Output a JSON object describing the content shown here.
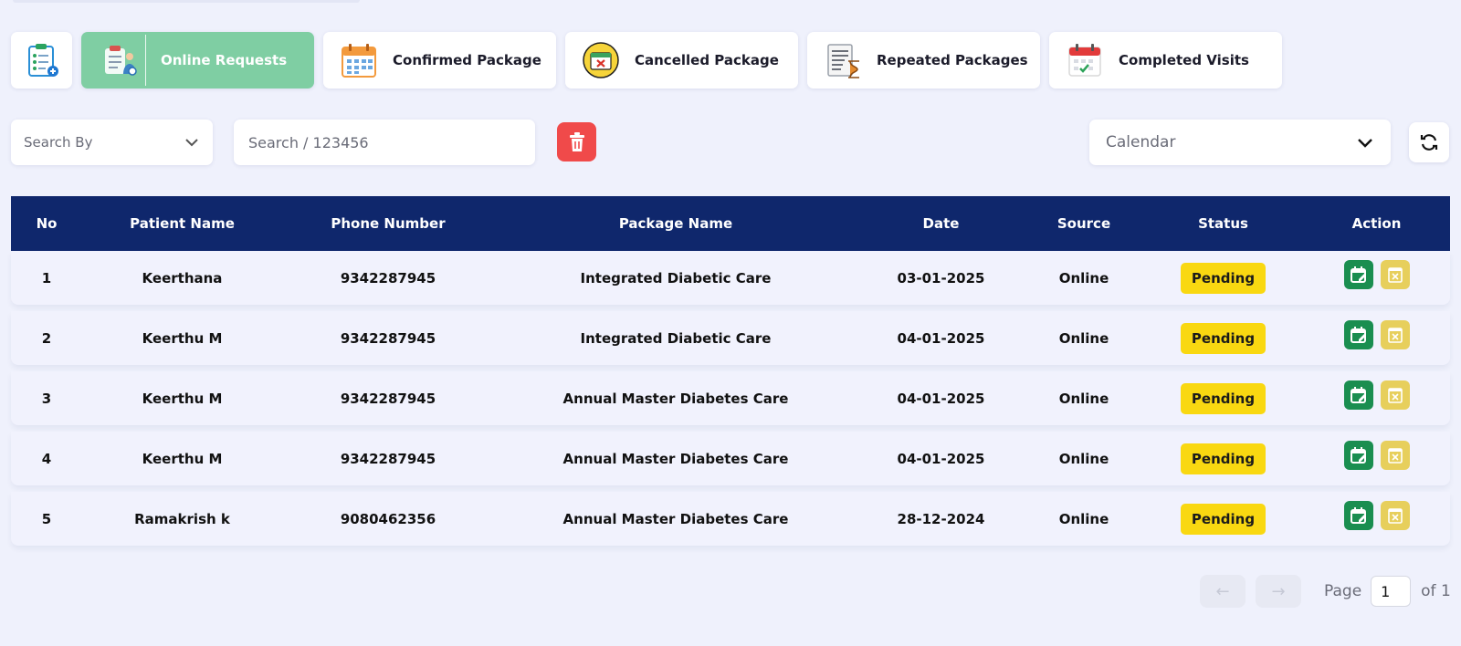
{
  "tabs": {
    "online": "Online Requests",
    "confirmed": "Confirmed Package",
    "cancelled": "Cancelled Package",
    "repeated": "Repeated Packages",
    "completed": "Completed Visits"
  },
  "filters": {
    "search_by": "Search By",
    "search_placeholder": "Search / 123456",
    "calendar": "Calendar"
  },
  "table": {
    "headers": [
      "No",
      "Patient Name",
      "Phone Number",
      "Package Name",
      "Date",
      "Source",
      "Status",
      "Action"
    ],
    "rows": [
      {
        "no": "1",
        "name": "Keerthana",
        "phone": "9342287945",
        "package": "Integrated Diabetic Care",
        "date": "03-01-2025",
        "source": "Online",
        "status": "Pending"
      },
      {
        "no": "2",
        "name": "Keerthu M",
        "phone": "9342287945",
        "package": "Integrated Diabetic Care",
        "date": "04-01-2025",
        "source": "Online",
        "status": "Pending"
      },
      {
        "no": "3",
        "name": "Keerthu M",
        "phone": "9342287945",
        "package": "Annual Master Diabetes Care",
        "date": "04-01-2025",
        "source": "Online",
        "status": "Pending"
      },
      {
        "no": "4",
        "name": "Keerthu M",
        "phone": "9342287945",
        "package": "Annual Master Diabetes Care",
        "date": "04-01-2025",
        "source": "Online",
        "status": "Pending"
      },
      {
        "no": "5",
        "name": "Ramakrish k",
        "phone": "9080462356",
        "package": "Annual Master Diabetes Care",
        "date": "28-12-2024",
        "source": "Online",
        "status": "Pending"
      }
    ]
  },
  "pagination": {
    "prev": "←",
    "next": "→",
    "page_label": "Page",
    "current": "1",
    "of_label": "of 1"
  },
  "colors": {
    "active_tab": "#7fcea3",
    "header": "#0f276c",
    "pending": "#f9d811",
    "delete": "#f04a4a",
    "confirm_action": "#1a8e50",
    "cancel_action": "#e7cf5c"
  },
  "icons": [
    "clipboard-icon",
    "clipboard-doctor-icon",
    "calendar-grid-icon",
    "calendar-cancel-icon",
    "document-hourglass-icon",
    "calendar-check-icon",
    "trash-icon",
    "chevron-down-icon",
    "refresh-icon",
    "calendar-edit-icon",
    "close-box-icon"
  ]
}
